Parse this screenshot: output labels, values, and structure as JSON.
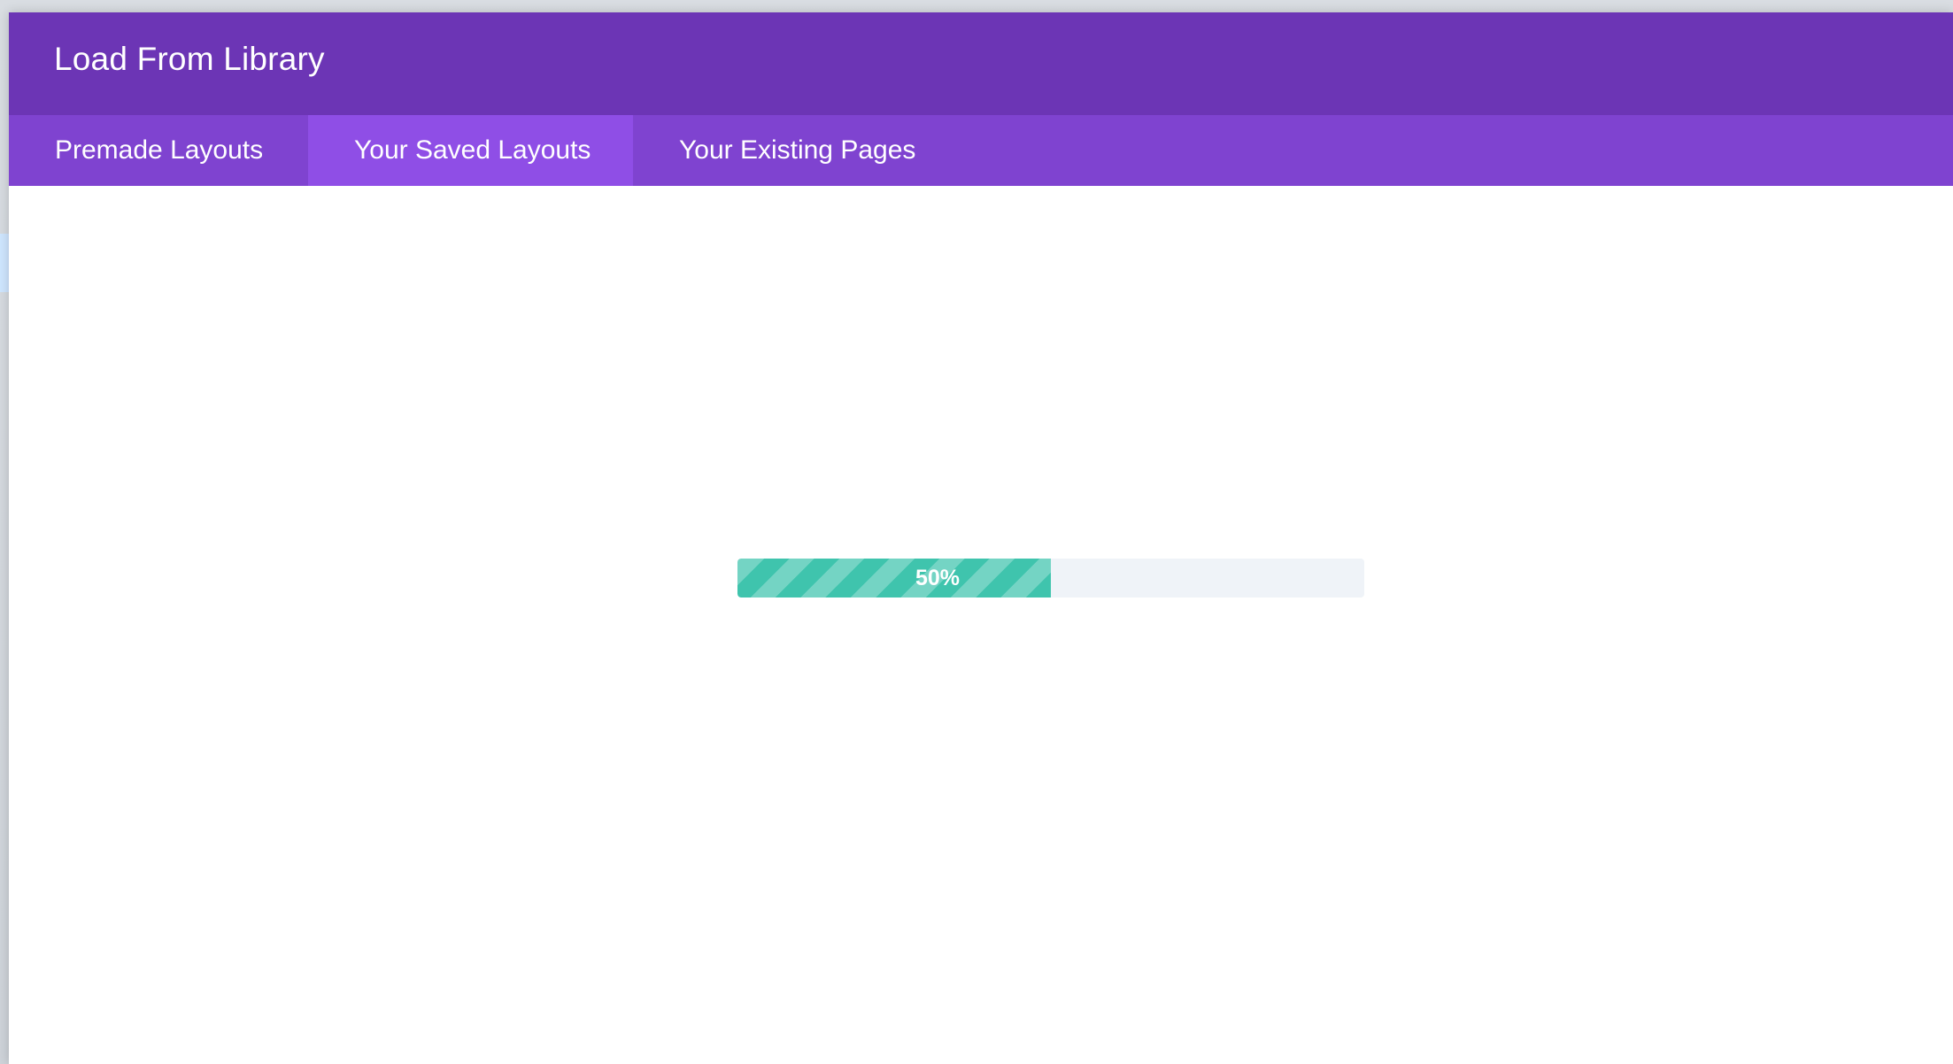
{
  "dialog": {
    "title": "Load From Library"
  },
  "tabs": [
    {
      "label": "Premade Layouts",
      "active": false
    },
    {
      "label": "Your Saved Layouts",
      "active": true
    },
    {
      "label": "Your Existing Pages",
      "active": false
    }
  ],
  "progress": {
    "value": 0.5,
    "label": "50%"
  },
  "colors": {
    "header": "#6c35b5",
    "tabs_bar": "#7f43d0",
    "tab_active": "#8f4ee6",
    "progress_fill": "#3fc4ad",
    "progress_track": "#eff3f8"
  }
}
